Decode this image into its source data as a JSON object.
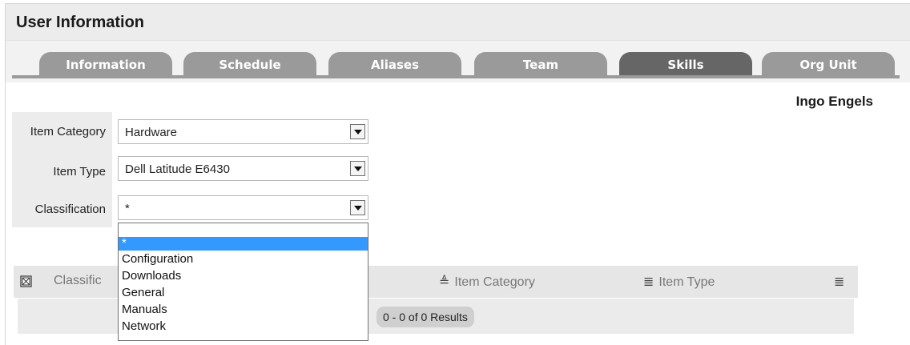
{
  "page": {
    "title": "User Information",
    "user_name": "Ingo Engels"
  },
  "tabs": [
    {
      "label": "Information",
      "active": false
    },
    {
      "label": "Schedule",
      "active": false
    },
    {
      "label": "Aliases",
      "active": false
    },
    {
      "label": "Team",
      "active": false
    },
    {
      "label": "Skills",
      "active": true
    },
    {
      "label": "Org Unit",
      "active": false
    }
  ],
  "form": {
    "item_category": {
      "label": "Item Category",
      "value": "Hardware"
    },
    "item_type": {
      "label": "Item Type",
      "value": "Dell Latitude E6430"
    },
    "classification": {
      "label": "Classification",
      "value": "*"
    }
  },
  "dropdown": {
    "options": [
      "",
      "*",
      "Configuration",
      "Downloads",
      "General",
      "Manuals",
      "Network"
    ],
    "selected": "*"
  },
  "grid": {
    "columns": {
      "classification": "Classific",
      "item_category": "Item Category",
      "item_type": "Item Type"
    },
    "results": "0 - 0 of 0 Results"
  },
  "colors": {
    "tab": "#9a9a9a",
    "tab_active": "#666666",
    "highlight": "#3399ff"
  }
}
